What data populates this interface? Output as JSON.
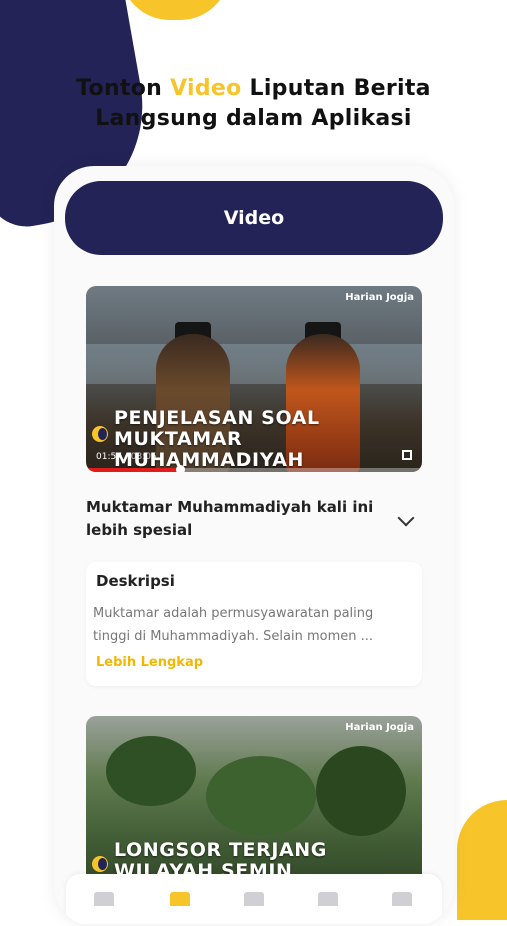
{
  "promo": {
    "headline_before": "Tonton ",
    "headline_accent": "Video",
    "headline_after": " Liputan Berita",
    "headline_line2": "Langsung dalam Aplikasi"
  },
  "app": {
    "header_title": "Video",
    "brand": "Harian Jogja"
  },
  "videos": [
    {
      "title_line1": "PENJELASAN SOAL",
      "title_line2": "MUKTAMAR MUHAMMADIYAH",
      "current_time": "01:57",
      "separator": "/",
      "duration": "03:05",
      "progress_fraction": 0.28
    },
    {
      "title_line1": "LONGSOR TERJANG",
      "title_line2": "WILAYAH SEMIN"
    }
  ],
  "article": {
    "title": "Muktamar Muhammadiyah kali ini lebih spesial",
    "description_heading": "Deskripsi",
    "description_text": "Muktamar adalah permusyawaratan paling tinggi di Muhammadiyah. Selain momen ...",
    "more_link": "Lebih Lengkap"
  },
  "tabbar": {
    "icons": [
      "home-icon",
      "video-icon",
      "category-icon",
      "bookmark-icon",
      "profile-icon"
    ],
    "active_index": 1
  },
  "colors": {
    "navy": "#242357",
    "yellow": "#F7C52A",
    "progress_red": "#e21b1b"
  }
}
